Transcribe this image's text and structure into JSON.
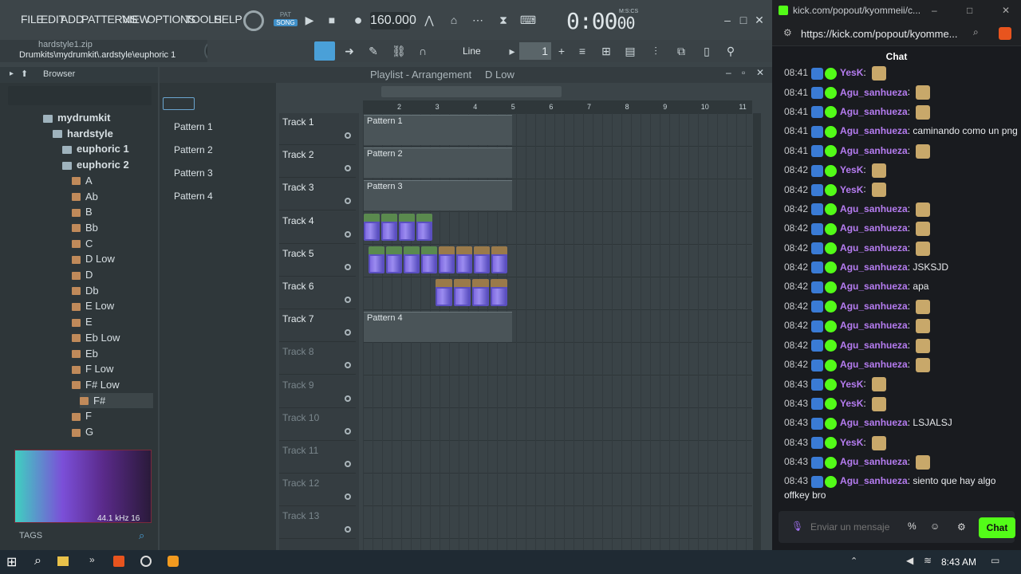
{
  "fl": {
    "menu": [
      "FILE",
      "EDIT",
      "ADD",
      "PATTERNS",
      "VIEW",
      "OPTIONS",
      "TOOLS",
      "HELP"
    ],
    "pat_label": "PAT",
    "song_label": "SONG",
    "tempo": "160.000",
    "time": "0:00",
    "time_frac": "00",
    "time_unit": "M:S:CS",
    "hint_file": "hardstyle1.zip",
    "hint_path": "Drumkits\\mydrumkit\\.ardstyle\\euphoric 1",
    "snap": "Line",
    "pattern_num": "1",
    "browser_title": "Browser",
    "tree": [
      {
        "label": "mydrumkit",
        "depth": 0,
        "kind": "folder"
      },
      {
        "label": "hardstyle",
        "depth": 1,
        "kind": "folder"
      },
      {
        "label": "euphoric 1",
        "depth": 2,
        "kind": "folder"
      },
      {
        "label": "euphoric 2",
        "depth": 2,
        "kind": "folder"
      },
      {
        "label": "A",
        "depth": 3,
        "kind": "file"
      },
      {
        "label": "Ab",
        "depth": 3,
        "kind": "file"
      },
      {
        "label": "B",
        "depth": 3,
        "kind": "file"
      },
      {
        "label": "Bb",
        "depth": 3,
        "kind": "file"
      },
      {
        "label": "C",
        "depth": 3,
        "kind": "file"
      },
      {
        "label": "D Low",
        "depth": 3,
        "kind": "file"
      },
      {
        "label": "D",
        "depth": 3,
        "kind": "file"
      },
      {
        "label": "Db",
        "depth": 3,
        "kind": "file"
      },
      {
        "label": "E Low",
        "depth": 3,
        "kind": "file"
      },
      {
        "label": "E",
        "depth": 3,
        "kind": "file"
      },
      {
        "label": "Eb Low",
        "depth": 3,
        "kind": "file"
      },
      {
        "label": "Eb",
        "depth": 3,
        "kind": "file"
      },
      {
        "label": "F Low",
        "depth": 3,
        "kind": "file"
      },
      {
        "label": "F# Low",
        "depth": 3,
        "kind": "file"
      },
      {
        "label": "F#",
        "depth": 4,
        "kind": "file"
      },
      {
        "label": "F",
        "depth": 3,
        "kind": "file"
      },
      {
        "label": "G",
        "depth": 3,
        "kind": "file"
      }
    ],
    "sample_info": "44.1 kHz 16",
    "tags_label": "TAGS",
    "patterns": [
      "Pattern 1",
      "Pattern 2",
      "Pattern 3",
      "Pattern 4"
    ],
    "playlist_title": "Playlist - Arrangement",
    "playlist_sub": "D Low",
    "ruler": [
      "2",
      "3",
      "4",
      "5",
      "6",
      "7",
      "8",
      "9",
      "10",
      "11"
    ],
    "tracks": [
      "Track 1",
      "Track 2",
      "Track 3",
      "Track 4",
      "Track 5",
      "Track 6",
      "Track 7",
      "Track 8",
      "Track 9",
      "Track 10",
      "Track 11",
      "Track 12",
      "Track 13"
    ],
    "clips": [
      "Pattern 1",
      "Pattern 2",
      "Pattern 3",
      "Pattern 4"
    ]
  },
  "browser_tab": {
    "url": "kick.com/popout/kyommeii/c...",
    "address": "https://kick.com/popout/kyomme...",
    "title": "Chat"
  },
  "chat": {
    "messages": [
      {
        "time": "08:41",
        "user": "YesK",
        "text": "",
        "user_color": "#b57cf0"
      },
      {
        "time": "08:41",
        "user": "Agu_sanhueza",
        "text": "",
        "user_color": "#b57cf0"
      },
      {
        "time": "08:41",
        "user": "Agu_sanhueza",
        "text": "",
        "user_color": "#b57cf0"
      },
      {
        "time": "08:41",
        "user": "Agu_sanhueza",
        "text": "caminando como un png",
        "user_color": "#b57cf0"
      },
      {
        "time": "08:41",
        "user": "Agu_sanhueza",
        "text": "",
        "user_color": "#b57cf0"
      },
      {
        "time": "08:42",
        "user": "YesK",
        "text": "",
        "user_color": "#b57cf0"
      },
      {
        "time": "08:42",
        "user": "YesK",
        "text": "",
        "user_color": "#b57cf0"
      },
      {
        "time": "08:42",
        "user": "Agu_sanhueza",
        "text": "",
        "user_color": "#b57cf0"
      },
      {
        "time": "08:42",
        "user": "Agu_sanhueza",
        "text": "",
        "user_color": "#b57cf0"
      },
      {
        "time": "08:42",
        "user": "Agu_sanhueza",
        "text": "",
        "user_color": "#b57cf0"
      },
      {
        "time": "08:42",
        "user": "Agu_sanhueza",
        "text": "JSKSJD",
        "user_color": "#b57cf0"
      },
      {
        "time": "08:42",
        "user": "Agu_sanhueza",
        "text": "apa",
        "user_color": "#b57cf0"
      },
      {
        "time": "08:42",
        "user": "Agu_sanhueza",
        "text": "",
        "user_color": "#b57cf0"
      },
      {
        "time": "08:42",
        "user": "Agu_sanhueza",
        "text": "",
        "user_color": "#b57cf0"
      },
      {
        "time": "08:42",
        "user": "Agu_sanhueza",
        "text": "",
        "user_color": "#b57cf0"
      },
      {
        "time": "08:42",
        "user": "Agu_sanhueza",
        "text": "",
        "user_color": "#b57cf0"
      },
      {
        "time": "08:43",
        "user": "YesK",
        "text": "",
        "user_color": "#b57cf0"
      },
      {
        "time": "08:43",
        "user": "YesK",
        "text": "",
        "user_color": "#b57cf0"
      },
      {
        "time": "08:43",
        "user": "Agu_sanhueza",
        "text": "LSJALSJ",
        "user_color": "#b57cf0"
      },
      {
        "time": "08:43",
        "user": "YesK",
        "text": "",
        "user_color": "#b57cf0"
      },
      {
        "time": "08:43",
        "user": "Agu_sanhueza",
        "text": "",
        "user_color": "#b57cf0"
      },
      {
        "time": "08:43",
        "user": "Agu_sanhueza",
        "text": "siento que hay algo",
        "user_color": "#b57cf0"
      }
    ],
    "last_line": "offkey bro",
    "input_placeholder": "Enviar un mensaje",
    "send_label": "Chat"
  },
  "taskbar": {
    "clock": "8:43 AM"
  }
}
